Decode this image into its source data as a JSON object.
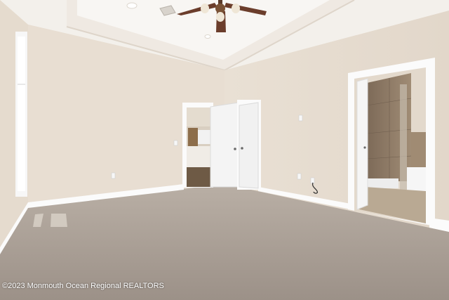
{
  "photo": {
    "watermark": "©2023 Monmouth Ocean Regional REALTORS"
  },
  "colors": {
    "wall": "#e7ddd1",
    "wall_shadow": "#ddd2c5",
    "ceiling": "#f4f1ec",
    "trim": "#fbfbfb",
    "carpet": "#aaa097",
    "tile": "#8c7a66",
    "door": "#f5f5f5"
  }
}
